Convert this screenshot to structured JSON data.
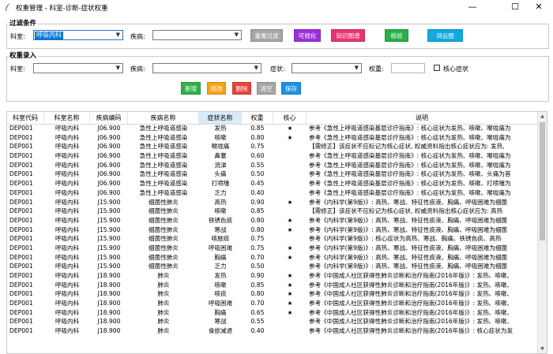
{
  "window": {
    "title": "权重管理 - 科室-诊断-症状权重"
  },
  "filter": {
    "group_title": "过滤条件",
    "dept_label": "科室:",
    "dept_value": "呼吸内科",
    "disease_label": "疾病:",
    "disease_value": "",
    "buttons": {
      "reset": "重置过滤",
      "visualize": "可视化",
      "graph": "知识图谱",
      "verify": "核验",
      "wordcloud": "词云图"
    }
  },
  "entry": {
    "group_title": "权重录入",
    "dept_label": "科室:",
    "disease_label": "疾病:",
    "symptom_label": "症状:",
    "weight_label": "权重:",
    "core_label": "核心症状",
    "buttons": {
      "add": "新增",
      "edit": "修改",
      "delete": "删除",
      "clear": "清空",
      "save": "保存"
    }
  },
  "colors": {
    "reset": "#a6a6a6",
    "visualize": "#9b30d9",
    "graph": "#e8356f",
    "verify": "#26b04a",
    "wordcloud": "#13a9e0",
    "add": "#30b04a",
    "edit": "#f5a318",
    "delete": "#e8443a",
    "clear": "#a6a6a6",
    "save": "#1e90e8"
  },
  "table": {
    "columns": [
      "科室代码",
      "科室名称",
      "疾病编码",
      "疾病名称",
      "症状名称",
      "权重",
      "核心",
      "说明"
    ],
    "rows": [
      [
        "DEP001",
        "呼吸内科",
        "J06.900",
        "急性上呼吸道感染",
        "发热",
        "0.85",
        "★",
        "参考《急性上呼吸道感染基层诊疗指南》: 核心症状为发热、咳嗽、喉咙痛为"
      ],
      [
        "DEP001",
        "呼吸内科",
        "J06.900",
        "急性上呼吸道感染",
        "咳嗽",
        "0.80",
        "★",
        "参考《急性上呼吸道感染基层诊疗指南》: 核心症状为发热、咳嗽、喉咙痛为"
      ],
      [
        "DEP001",
        "呼吸内科",
        "J06.900",
        "急性上呼吸道感染",
        "喉咙痛",
        "0.75",
        "",
        "【需修正】该症状不应标记为核心症状, 权威资料指出核心症状应为: 发热,"
      ],
      [
        "DEP001",
        "呼吸内科",
        "J06.900",
        "急性上呼吸道感染",
        "鼻塞",
        "0.60",
        "",
        "参考《急性上呼吸道感染基层诊疗指南》: 核心症状为发热、咳嗽、喉咙痛为"
      ],
      [
        "DEP001",
        "呼吸内科",
        "J06.900",
        "急性上呼吸道感染",
        "流涕",
        "0.55",
        "",
        "参考《急性上呼吸道感染基层诊疗指南》: 核心症状为发热、咳嗽、喉咙痛为"
      ],
      [
        "DEP001",
        "呼吸内科",
        "J06.900",
        "急性上呼吸道感染",
        "头痛",
        "0.50",
        "",
        "参考《急性上呼吸道感染基层诊疗指南》: 核心症状为发热、咳嗽、头痛为首"
      ],
      [
        "DEP001",
        "呼吸内科",
        "J06.900",
        "急性上呼吸道感染",
        "打喷嚏",
        "0.45",
        "",
        "参考《急性上呼吸道感染基层诊疗指南》: 核心症状为发热、咳嗽、打喷嚏为"
      ],
      [
        "DEP001",
        "呼吸内科",
        "J06.900",
        "急性上呼吸道感染",
        "乏力",
        "0.40",
        "",
        "参考《急性上呼吸道感染基层诊疗指南》: 核心症状为发热、咳嗽、喉咙痛为"
      ],
      [
        "DEP001",
        "呼吸内科",
        "J15.900",
        "细菌性肺炎",
        "高热",
        "0.90",
        "★",
        "参考《内科学(第9版)》: 高热、寒战、特征性痰液、胸痛、呼吸困难为细菌"
      ],
      [
        "DEP001",
        "呼吸内科",
        "J15.900",
        "细菌性肺炎",
        "咳嗽",
        "0.85",
        "",
        "【需修正】该症状不应标记为核心症状, 权威资料指出核心症状应为: 高热"
      ],
      [
        "DEP001",
        "呼吸内科",
        "J15.900",
        "细菌性肺炎",
        "铁锈色痰",
        "0.80",
        "★",
        "参考《内科学(第9版)》: 高热、寒战、特征性痰液、胸痛、呼吸困难为细菌"
      ],
      [
        "DEP001",
        "呼吸内科",
        "J15.900",
        "细菌性肺炎",
        "寒战",
        "0.80",
        "★",
        "参考《内科学(第9版)》: 高热、寒战、特征性痰液、胸痛、呼吸困难为细菌"
      ],
      [
        "DEP001",
        "呼吸内科",
        "J15.900",
        "细菌性肺炎",
        "咳脓痰",
        "0.75",
        "",
        "参考《内科学(第9版)》: 核心症状为高热、寒战、胸痛、铁锈色痰、高热"
      ],
      [
        "DEP001",
        "呼吸内科",
        "J15.900",
        "细菌性肺炎",
        "呼吸困难",
        "0.75",
        "★",
        "参考《内科学(第9版)》: 高热、寒战、特征性痰液、胸痛、呼吸困难为细菌"
      ],
      [
        "DEP001",
        "呼吸内科",
        "J15.900",
        "细菌性肺炎",
        "胸痛",
        "0.70",
        "★",
        "参考《内科学(第9版)》: 高热、寒战、特征性痰液、胸痛、呼吸困难为细菌"
      ],
      [
        "DEP001",
        "呼吸内科",
        "J15.900",
        "细菌性肺炎",
        "乏力",
        "0.50",
        "",
        "参考《内科学(第9版)》: 高热、寒战、特征性痰液、胸痛、呼吸困难为细菌"
      ],
      [
        "DEP001",
        "呼吸内科",
        "J18.900",
        "肺炎",
        "发热",
        "0.90",
        "★",
        "参考《中国成人社区获得性肺炎诊断和治疗指南(2016年版)》: 发热、咳嗽、"
      ],
      [
        "DEP001",
        "呼吸内科",
        "J18.900",
        "肺炎",
        "咳嗽",
        "0.85",
        "★",
        "参考《中国成人社区获得性肺炎诊断和治疗指南(2016年版)》: 发热、咳嗽、"
      ],
      [
        "DEP001",
        "呼吸内科",
        "J18.900",
        "肺炎",
        "咳痰",
        "0.80",
        "★",
        "参考《中国成人社区获得性肺炎诊断和治疗指南(2016年版)》: 发热、咳嗽、"
      ],
      [
        "DEP001",
        "呼吸内科",
        "J18.900",
        "肺炎",
        "呼吸困难",
        "0.70",
        "★",
        "参考《中国成人社区获得性肺炎诊断和治疗指南(2016年版)》: 发热、咳嗽、"
      ],
      [
        "DEP001",
        "呼吸内科",
        "J18.900",
        "肺炎",
        "胸痛",
        "0.65",
        "★",
        "参考《中国成人社区获得性肺炎诊断和治疗指南(2016年版)》: 发热、咳嗽、"
      ],
      [
        "DEP001",
        "呼吸内科",
        "J18.900",
        "肺炎",
        "寒战",
        "0.55",
        "",
        "参考《中国成人社区获得性肺炎诊断和治疗指南(2016年版)》: 发热、咳嗽、"
      ],
      [
        "DEP001",
        "呼吸内科",
        "J18.900",
        "肺炎",
        "食欲减退",
        "0.40",
        "",
        "参考《中国成人社区获得性肺炎诊断和治疗指南(2016年版)》: 核心症状为发"
      ]
    ]
  }
}
